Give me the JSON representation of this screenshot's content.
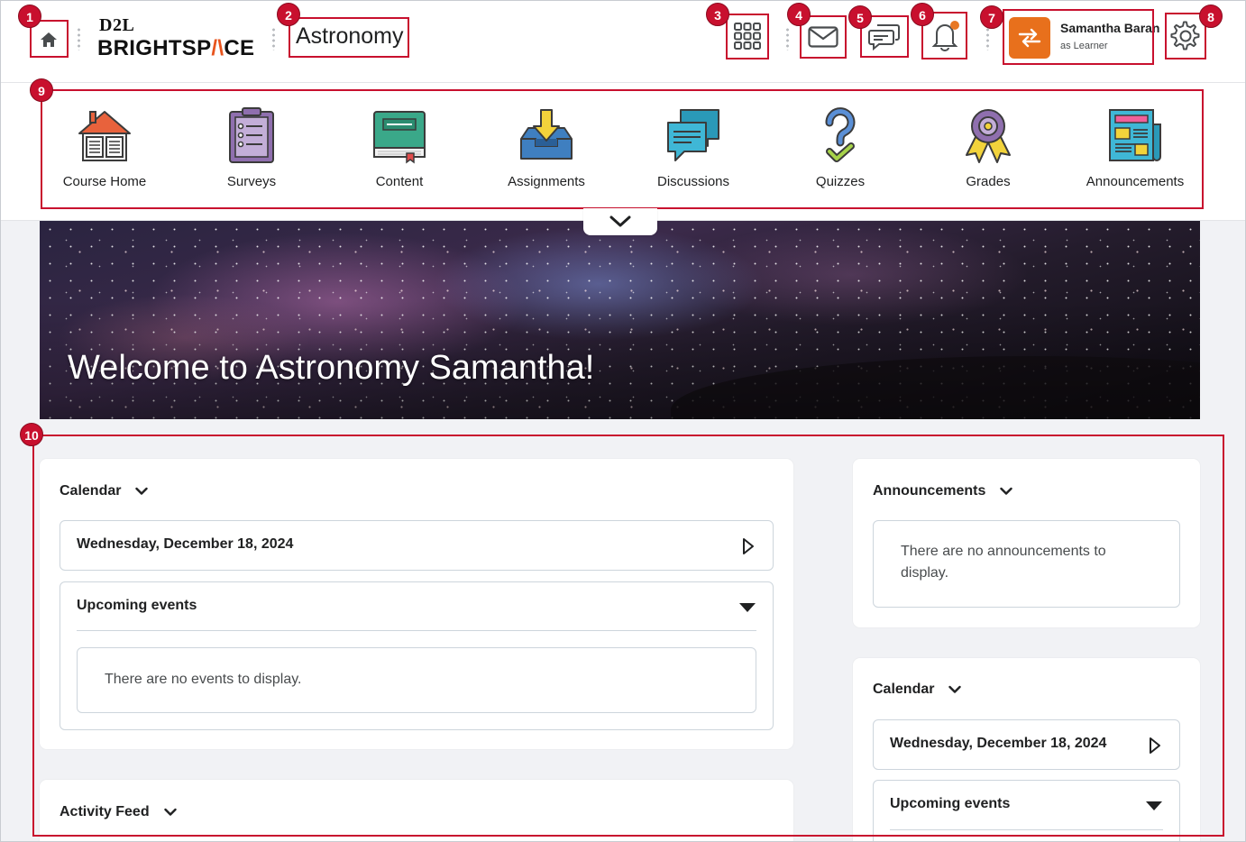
{
  "header": {
    "logo_top": "D2L",
    "logo_bottom_a": "BRIGHTSP",
    "logo_bottom_accent": "/\\",
    "logo_bottom_b": "CE",
    "course_title": "Astronomy",
    "user": {
      "name": "Samantha Baran",
      "role": "as Learner"
    },
    "icons": [
      "home-icon",
      "waffle-grid-icon",
      "mail-icon",
      "chat-icon",
      "bell-icon",
      "role-switch-icon",
      "gear-icon"
    ]
  },
  "callouts": [
    "1",
    "2",
    "3",
    "4",
    "5",
    "6",
    "7",
    "8",
    "9",
    "10"
  ],
  "nav": {
    "items": [
      {
        "label": "Course Home"
      },
      {
        "label": "Surveys"
      },
      {
        "label": "Content"
      },
      {
        "label": "Assignments"
      },
      {
        "label": "Discussions"
      },
      {
        "label": "Quizzes"
      },
      {
        "label": "Grades"
      },
      {
        "label": "Announcements"
      }
    ]
  },
  "banner": {
    "title": "Welcome to Astronomy Samantha!"
  },
  "left_column": {
    "calendar": {
      "title": "Calendar",
      "date": "Wednesday, December 18, 2024",
      "upcoming_title": "Upcoming events",
      "empty_message": "There are no events to display."
    },
    "activity_feed": {
      "title": "Activity Feed"
    }
  },
  "right_column": {
    "announcements": {
      "title": "Announcements",
      "empty_message": "There are no announcements to display."
    },
    "calendar": {
      "title": "Calendar",
      "date": "Wednesday, December 18, 2024",
      "upcoming_title": "Upcoming events"
    }
  },
  "colors": {
    "callout_red": "#c8102e",
    "brand_orange": "#e8701c",
    "notification_dot": "#e87722"
  }
}
